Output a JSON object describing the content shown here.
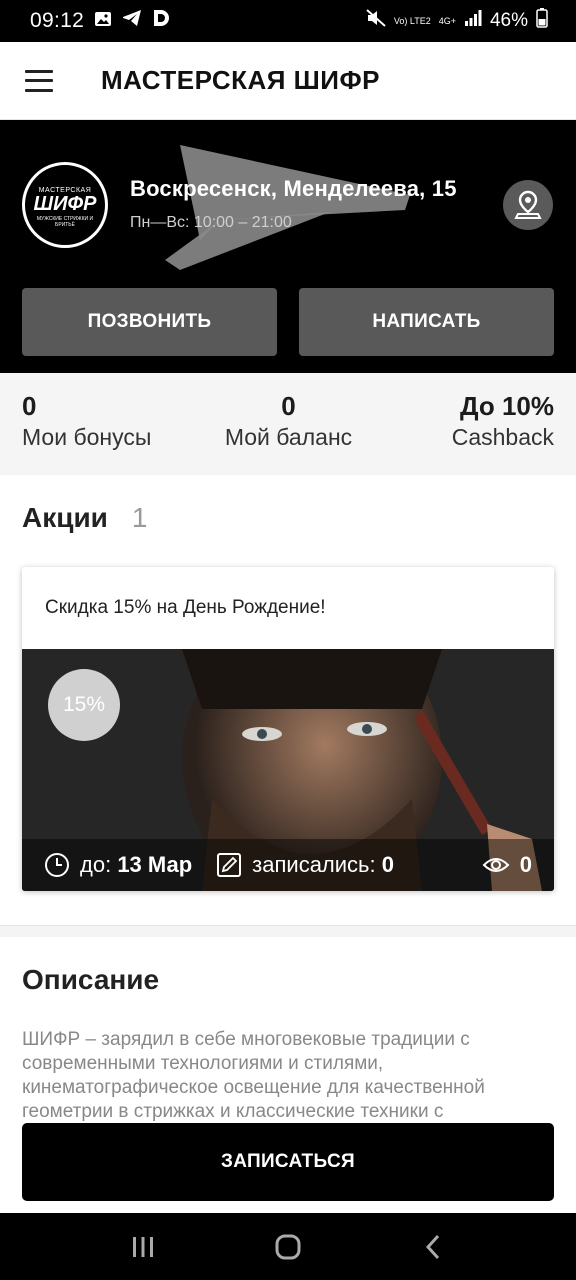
{
  "status_bar": {
    "time": "09:12",
    "network": "Vo) LTE2",
    "signal": "4G+",
    "battery": "46%"
  },
  "app_bar": {
    "title": "МАСТЕРСКАЯ ШИФР"
  },
  "hero": {
    "logo": {
      "top": "МАСТЕРСКАЯ",
      "main": "ШИФР",
      "sub": "МУЖСКИЕ СТРИЖКИ И БРИТЬЁ"
    },
    "address": "Воскресенск, Менделеева, 15",
    "hours": "Пн—Вс: 10:00 – 21:00",
    "call_label": "ПОЗВОНИТЬ",
    "write_label": "НАПИСАТЬ"
  },
  "stats": [
    {
      "value": "0",
      "label": "Мои бонусы"
    },
    {
      "value": "0",
      "label": "Мой баланс"
    },
    {
      "value": "До 10%",
      "label": "Cashback"
    }
  ],
  "promotions": {
    "title": "Акции",
    "count": "1",
    "card": {
      "title": "Скидка 15% на День Рождение!",
      "badge": "15%",
      "until_label": "до:",
      "until_value": "13 Мар",
      "signed_label": "записались:",
      "signed_value": "0",
      "views_value": "0"
    }
  },
  "description": {
    "title": "Описание",
    "text": "ШИФР – зарядил в себе многовековые традиции с современными технологиями и стилями, кинематографическое освещение для качественной геометрии в стрижках и классические техники с"
  },
  "book_button": "ЗАПИСАТЬСЯ",
  "colors": {
    "hero_bg": "#000000",
    "hero_button": "#595959",
    "stats_bg": "#f5f5f5",
    "badge": "#d0d0d0"
  }
}
